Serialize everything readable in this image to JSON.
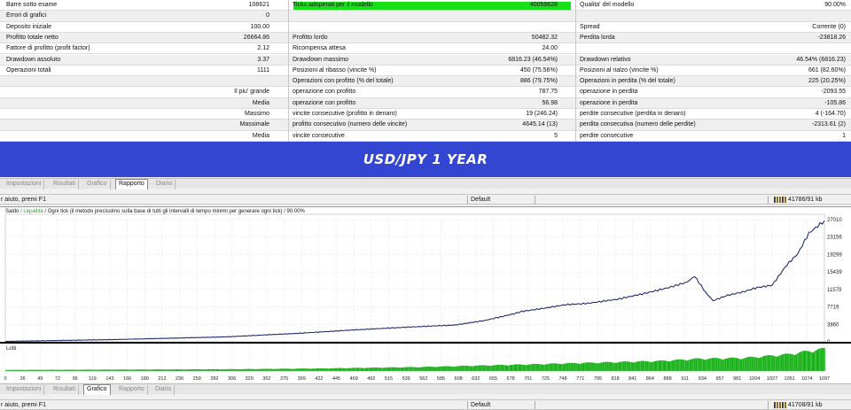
{
  "report": {
    "rows": [
      {
        "c1": "Barre sotto esame",
        "c2": "108621",
        "c3": "Ticks adoperati per il modello",
        "c4": "40059628",
        "c5": "Qualita' del modello",
        "c6": "90.00%"
      },
      {
        "c1": "Errori di grafici",
        "c2": "0",
        "c3": "",
        "c4": "",
        "c5": "",
        "c6": ""
      },
      {
        "c1": "Deposito iniziale",
        "c2": "100.00",
        "c3": "",
        "c4": "",
        "c5": "Spread",
        "c6": "Corrente (0)"
      },
      {
        "c1": "Profitto totale netto",
        "c2": "26664.86",
        "c3": "Profitto lordo",
        "c4": "50482.32",
        "c5": "Perdita lorda",
        "c6": "-23818.26"
      },
      {
        "c1": "Fattore di profitto (profit factor)",
        "c2": "2.12",
        "c3": "Ricompensa attesa",
        "c4": "24.00",
        "c5": "",
        "c6": ""
      },
      {
        "c1": "Drawdown assoluto",
        "c2": "3.37",
        "c3": "Drawdown massimo",
        "c4": "6816.23 (46.54%)",
        "c5": "Drawdown relativo",
        "c6": "46.54% (6816.23)"
      },
      {
        "c1": "Operazioni totali",
        "c2": "1111",
        "c3": "Posizioni al ribasso (vincite %)",
        "c4": "450 (75.56%)",
        "c5": "Posizioni al rialzo (vincite %)",
        "c6": "661 (82.60%)"
      },
      {
        "c1": "",
        "c2": "",
        "c3": "Operazioni con profitto (% del totale)",
        "c4": "886 (79.75%)",
        "c5": "Operazioni in perdita (% del totale)",
        "c6": "225 (20.25%)"
      },
      {
        "c1": "",
        "c2": "Il piu' grande",
        "c3": "operazione con profitto",
        "c4": "787.75",
        "c5": "operazione in perdita",
        "c6": "-2093.55"
      },
      {
        "c1": "",
        "c2": "Media",
        "c3": "operazione con profitto",
        "c4": "56.98",
        "c5": "operazione in perdita",
        "c6": "-105.86"
      },
      {
        "c1": "",
        "c2": "Massimo",
        "c3": "vincite consecutive (profitto in denaro)",
        "c4": "19 (246.24)",
        "c5": "perdite consecutive (perdita in denaro)",
        "c6": "4 (-164.70)"
      },
      {
        "c1": "",
        "c2": "Massimale",
        "c3": "profitto consecutivo (numero delle vincite)",
        "c4": "4645.14 (13)",
        "c5": "perdita consecutiva (numero delle perdite)",
        "c6": "-2313.61 (2)"
      },
      {
        "c1": "",
        "c2": "Media",
        "c3": "vincite consecutive",
        "c4": "5",
        "c5": "perdite consecutive",
        "c6": "1"
      }
    ]
  },
  "banner": {
    "text": "USD/JPY 1 YEAR"
  },
  "tabs_top": [
    "Impostazioni",
    "Risultati",
    "Grafico",
    "Rapporto",
    "Diario"
  ],
  "tabs_top_active": "Rapporto",
  "tabs_bottom": [
    "Impostazioni",
    "Risultati",
    "Grafico",
    "Rapporto",
    "Diario"
  ],
  "tabs_bottom_active": "Grafico",
  "status_top": {
    "help": "r aiuto, premi F1",
    "profile": "Default",
    "memory": "41786/91 kb"
  },
  "status_bottom": {
    "help": "r aiuto, premi F1",
    "profile": "Default",
    "memory": "41708/91 kb"
  },
  "chart_header": {
    "saldo": "Saldo",
    "liquidita": "Liquidità",
    "description": "Ogni tick (il metodo precissimo sulla base di tutti gli intervalli di tempo minimi per generare ogni tick)",
    "quality": "90.00%"
  },
  "colors": {
    "balance": "#1f2d6e",
    "lots": "#19b219",
    "banner": "#3346d2",
    "quality_bar": "#18e018"
  },
  "chart_data": {
    "type": "line",
    "title": "",
    "y_ticks": [
      "27010",
      "23156",
      "19299",
      "15439",
      "11579",
      "7719",
      "3860",
      "0"
    ],
    "y_tick_values": [
      27010,
      23156,
      19299,
      15439,
      11579,
      7719,
      3860,
      0
    ],
    "ylim": [
      0,
      27010
    ],
    "x_ticks": [
      "0",
      "26",
      "49",
      "72",
      "96",
      "119",
      "143",
      "166",
      "189",
      "212",
      "236",
      "259",
      "282",
      "306",
      "329",
      "352",
      "375",
      "399",
      "422",
      "445",
      "469",
      "492",
      "515",
      "539",
      "562",
      "585",
      "608",
      "632",
      "655",
      "678",
      "701",
      "725",
      "748",
      "771",
      "795",
      "818",
      "841",
      "864",
      "888",
      "911",
      "934",
      "957",
      "981",
      "1004",
      "1027",
      "1051",
      "1074",
      "1097"
    ],
    "xlim": [
      0,
      1111
    ],
    "lots_label": "Lotti",
    "series": [
      {
        "name": "Saldo",
        "x": [
          0,
          150,
          300,
          400,
          470,
          540,
          580,
          610,
          650,
          690,
          700,
          730,
          760,
          790,
          830,
          870,
          900,
          925,
          935,
          950,
          960,
          980,
          1000,
          1020,
          1040,
          1060,
          1075,
          1090,
          1111
        ],
        "values": [
          100,
          500,
          1100,
          1900,
          2600,
          3200,
          3500,
          3700,
          4700,
          6200,
          6700,
          7400,
          8200,
          8500,
          9400,
          10800,
          12000,
          13200,
          14500,
          10900,
          9100,
          10300,
          11000,
          12000,
          12500,
          17000,
          19500,
          24000,
          26764
        ]
      },
      {
        "name": "Lotti",
        "x": [
          0,
          300,
          420,
          560,
          720,
          890,
          940,
          1000,
          1060,
          1111
        ],
        "values": [
          0.3,
          0.5,
          0.7,
          1.1,
          1.9,
          2.8,
          3.4,
          3.6,
          4.6,
          6.2
        ]
      }
    ]
  }
}
